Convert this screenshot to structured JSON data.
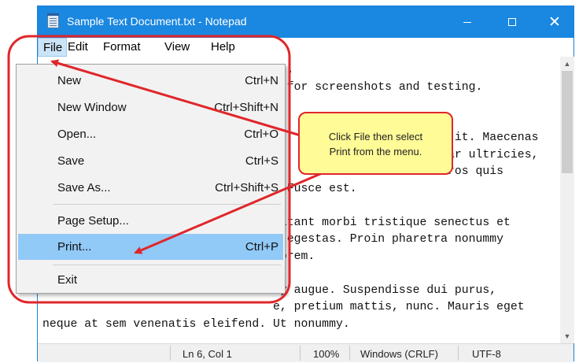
{
  "window": {
    "title": "Sample Text Document.txt - Notepad",
    "controls": {
      "minimize": "minimize",
      "maximize": "maximize",
      "close": "✕"
    }
  },
  "menubar": [
    "File",
    "Edit",
    "Format",
    "View",
    "Help"
  ],
  "file_menu": {
    "items": [
      {
        "label": "New",
        "shortcut": "Ctrl+N"
      },
      {
        "label": "New Window",
        "shortcut": "Ctrl+Shift+N"
      },
      {
        "label": "Open...",
        "shortcut": "Ctrl+O"
      },
      {
        "label": "Save",
        "shortcut": "Ctrl+S"
      },
      {
        "label": "Save As...",
        "shortcut": "Ctrl+Shift+S"
      },
      {
        "label": "Page Setup...",
        "shortcut": ""
      },
      {
        "label": "Print...",
        "shortcut": "Ctrl+P",
        "highlighted": true
      },
      {
        "label": "Exit",
        "shortcut": ""
      }
    ]
  },
  "document_text": "                                   .\n                                 d for screenshots and testing.\n                                 :\n\n                                 c                         it. Maecenas\n                                 u                       har ultricies,\n                                 t                       eros quis\n                                 . Fusce est.\n\n                                 bitant morbi tristique senectus et\n                                 s egestas. Proin pharetra nonummy\n                                 lorem.\n\n                                 my augue. Suspendisse dui purus,\n                                 e, pretium mattis, nunc. Mauris eget\nneque at sem venenatis eleifend. Ut nonummy.",
  "status": {
    "position": "Ln 6, Col 1",
    "zoom": "100%",
    "line_ending": "Windows (CRLF)",
    "encoding": "UTF-8"
  },
  "callout": {
    "line1": "Click File then select",
    "line2": "Print from the menu."
  },
  "colors": {
    "titlebar": "#1a87e0",
    "annotation_red": "#e0262a",
    "menu_highlight": "#91c9f7",
    "callout_fill": "#fffb97"
  }
}
